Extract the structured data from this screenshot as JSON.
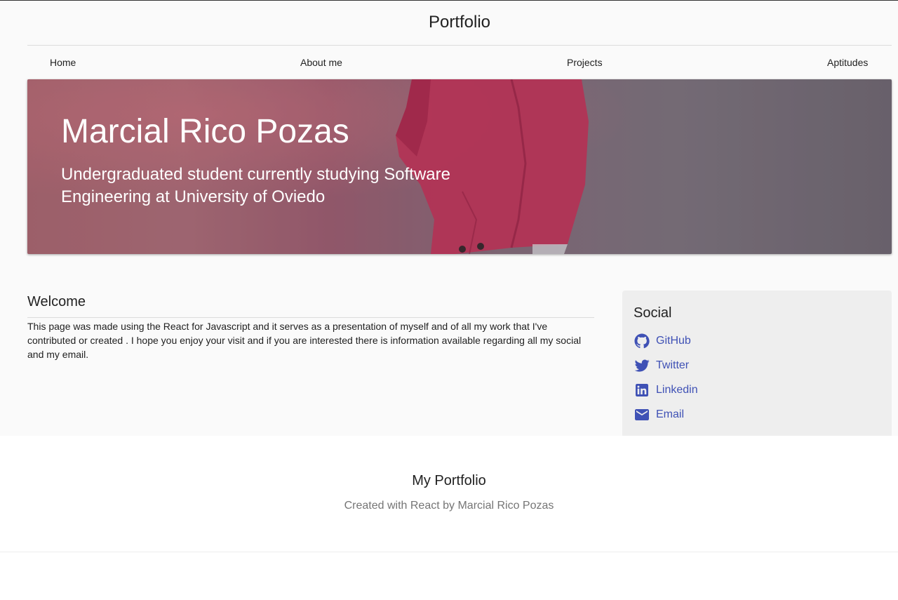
{
  "header": {
    "title": "Portfolio"
  },
  "nav": {
    "items": [
      {
        "label": "Home"
      },
      {
        "label": "About me"
      },
      {
        "label": "Projects"
      },
      {
        "label": "Aptitudes"
      }
    ]
  },
  "hero": {
    "title": "Marcial Rico Pozas",
    "subtitle": "Undergraduated student currently studying Software Engineering at University of Oviedo"
  },
  "welcome": {
    "heading": "Welcome",
    "body": "This page was made using the React for Javascript and it serves as a presentation of myself and of all my work that I've contributed or created . I hope you enjoy your visit and if you are interested there is information available regarding all my social and my email."
  },
  "social": {
    "heading": "Social",
    "links": [
      {
        "label": "GitHub",
        "icon": "github-icon"
      },
      {
        "label": "Twitter",
        "icon": "twitter-icon"
      },
      {
        "label": "Linkedin",
        "icon": "linkedin-icon"
      },
      {
        "label": "Email",
        "icon": "email-icon"
      }
    ]
  },
  "footer": {
    "title": "My Portfolio",
    "subtitle": "Created with React by Marcial Rico Pozas"
  },
  "colors": {
    "link": "#3f51b5",
    "page_background": "#fafafa",
    "sidebar_background": "#eeeeee",
    "hero_accent": "#d2375f"
  }
}
